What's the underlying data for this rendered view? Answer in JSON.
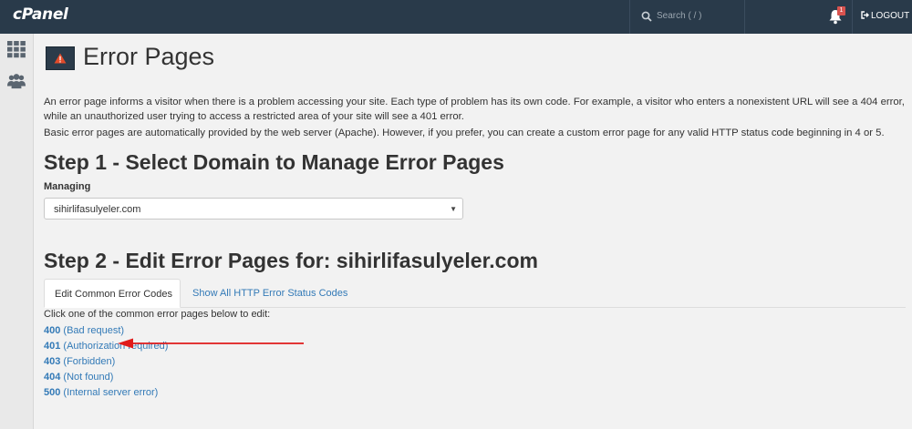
{
  "topbar": {
    "logo": "cPanel",
    "search_placeholder": "Search ( / )",
    "notification_count": "1",
    "logout_label": "LOGOUT"
  },
  "rail": {
    "items": [
      {
        "icon": "grid-icon"
      },
      {
        "icon": "users-icon"
      }
    ]
  },
  "page": {
    "title": "Error Pages",
    "intro_1": "An error page informs a visitor when there is a problem accessing your site. Each type of problem has its own code. For example, a visitor who enters a nonexistent URL will see a 404 error, while an unauthorized user trying to access a restricted area of your site will see a 401 error.",
    "intro_2": "Basic error pages are automatically provided by the web server (Apache). However, if you prefer, you can create a custom error page for any valid HTTP status code beginning in 4 or 5.",
    "step1_title": "Step 1 - Select Domain to Manage Error Pages",
    "managing_label": "Managing",
    "domain_selected": "sihirlifasulyeler.com",
    "step2_title": "Step 2 - Edit Error Pages for: sihirlifasulyeler.com",
    "tabs": [
      {
        "label": "Edit Common Error Codes",
        "active": true
      },
      {
        "label": "Show All HTTP Error Status Codes",
        "active": false
      }
    ],
    "instructions": "Click one of the common error pages below to edit:",
    "errors": [
      {
        "code": "400",
        "desc": "(Bad request)"
      },
      {
        "code": "401",
        "desc": "(Authorization required)"
      },
      {
        "code": "403",
        "desc": "(Forbidden)"
      },
      {
        "code": "404",
        "desc": "(Not found)"
      },
      {
        "code": "500",
        "desc": "(Internal server error)"
      }
    ]
  },
  "colors": {
    "topbar": "#293a4a",
    "link": "#337ab7",
    "annotation_arrow": "#e01b1b",
    "badge": "#d9534f"
  }
}
